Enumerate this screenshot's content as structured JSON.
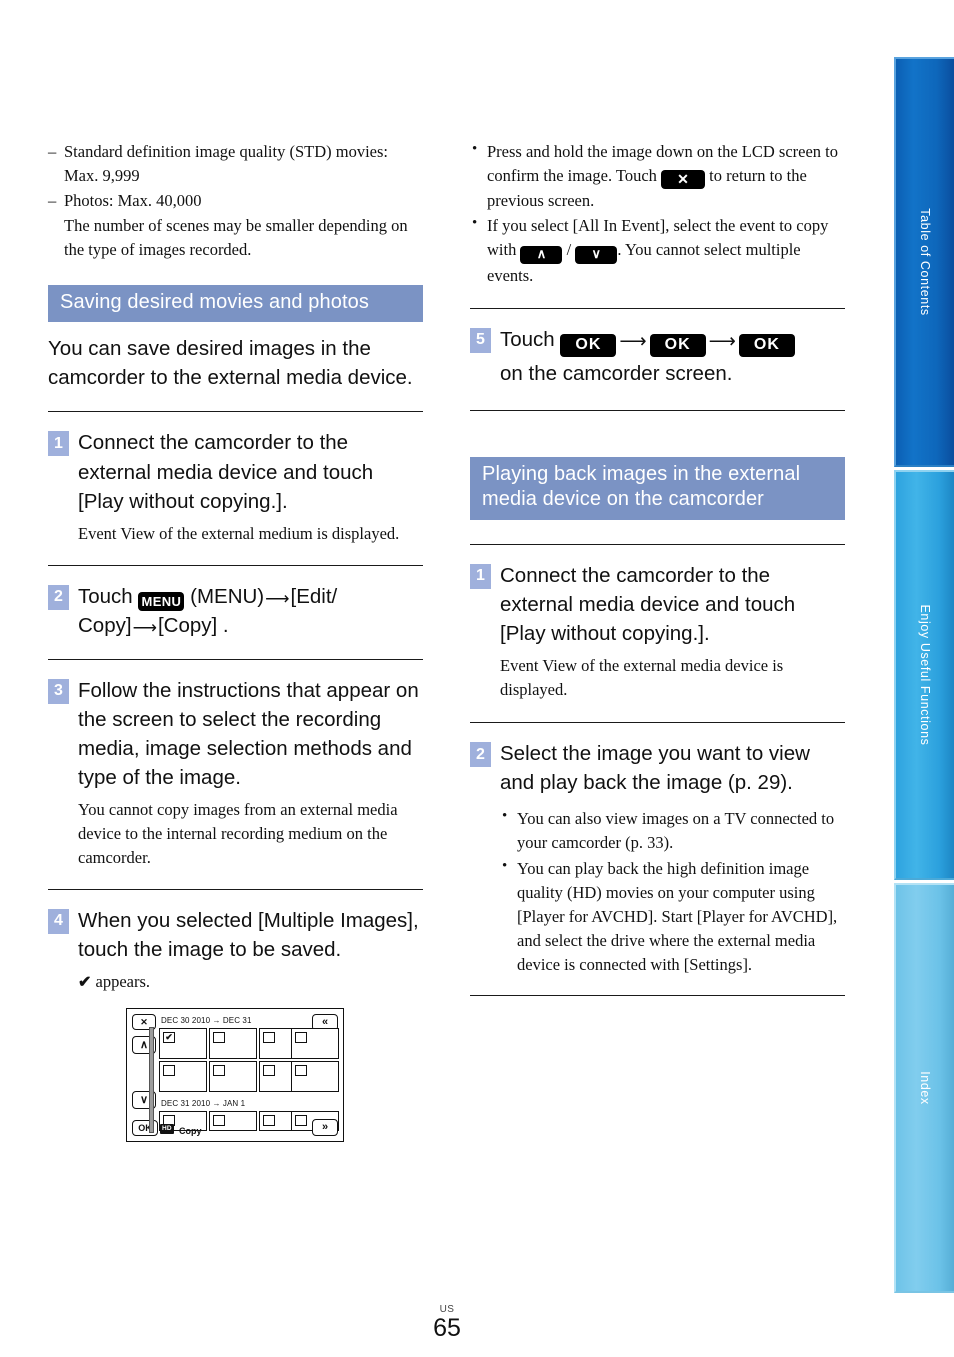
{
  "page": {
    "number": "65",
    "region_code": "US"
  },
  "sidebar": {
    "tabs": [
      {
        "label": "Table of Contents",
        "color": "#0e67bb"
      },
      {
        "label": "Enjoy Useful Functions",
        "color": "#2ba0dd"
      },
      {
        "label": "Index",
        "color": "#6bc2e8"
      }
    ]
  },
  "left_column": {
    "intro_list": [
      {
        "marker": "–",
        "text": "Standard definition image quality (STD) movies: Max. 9,999"
      },
      {
        "marker": "–",
        "text": "Photos: Max. 40,000"
      }
    ],
    "intro_note": "The number of scenes may be smaller depending on the type of images recorded.",
    "section_heading": "Saving desired movies and photos",
    "section_intro": "You can save desired images in the camcorder to the external media device.",
    "steps": [
      {
        "number": "1",
        "text_parts": {
          "main": "Connect the camcorder to the external media device and touch [Play without copying.]."
        },
        "sub": "Event View of the external medium is displayed."
      },
      {
        "number": "2",
        "touch_label": "Touch",
        "menu_key": "MENU",
        "menu_paren": "(MENU)",
        "arrow": "⟶",
        "path_1": "[Edit/ Copy]",
        "path_2": "[Copy] ."
      },
      {
        "number": "3",
        "text_parts": {
          "main": "Follow the instructions that appear on the screen to select the recording media, image selection methods and type of the image."
        },
        "sub": "You cannot copy images from an external media device to the internal recording medium on the camcorder."
      },
      {
        "number": "4",
        "text_parts": {
          "main": "When you selected [Multiple Images], touch the image to be saved."
        },
        "sub_check": "✔",
        "sub": "appears."
      }
    ],
    "lcd": {
      "close_button": "✕",
      "up_button": "∧",
      "down_button": "∨",
      "page_up_button": "«",
      "page_down_button": "»",
      "ok_button": "OK",
      "event_1_date": "DEC 30 2010 → DEC 31",
      "event_2_date": "DEC 31 2010 → JAN 1",
      "checked_mark": "✔",
      "hd_badge": "HD",
      "copy_label": "Copy"
    }
  },
  "right_column": {
    "top_bullets": [
      {
        "before": "Press and hold the image down on the LCD screen to confirm the image. Touch",
        "key": "✕",
        "after": "to return to the previous screen."
      },
      {
        "before": "If you select [All In Event], select the event to copy with",
        "key_up": "∧",
        "separator": "/",
        "key_down": "∨",
        "after": ". You cannot select multiple events."
      }
    ],
    "step5": {
      "number": "5",
      "touch_label": "Touch",
      "ok_key": "OK",
      "arrow": "⟶",
      "tail": "on the camcorder screen."
    },
    "section_heading": "Playing back images in the external media device on the camcorder",
    "steps": [
      {
        "number": "1",
        "text_parts": {
          "main": "Connect the camcorder to the external media device and touch [Play without copying.]."
        },
        "sub": "Event View of the external media device is displayed."
      },
      {
        "number": "2",
        "text_parts": {
          "main": "Select the image you want to view and play back the image (p. 29)."
        }
      }
    ],
    "bottom_bullets": [
      "You can also view images on a TV connected to your camcorder (p. 33).",
      "You can play back the high definition image quality (HD) movies on your computer using [Player for AVCHD]. Start [Player for AVCHD], and select the drive where the external media device is connected with [Settings]."
    ]
  }
}
